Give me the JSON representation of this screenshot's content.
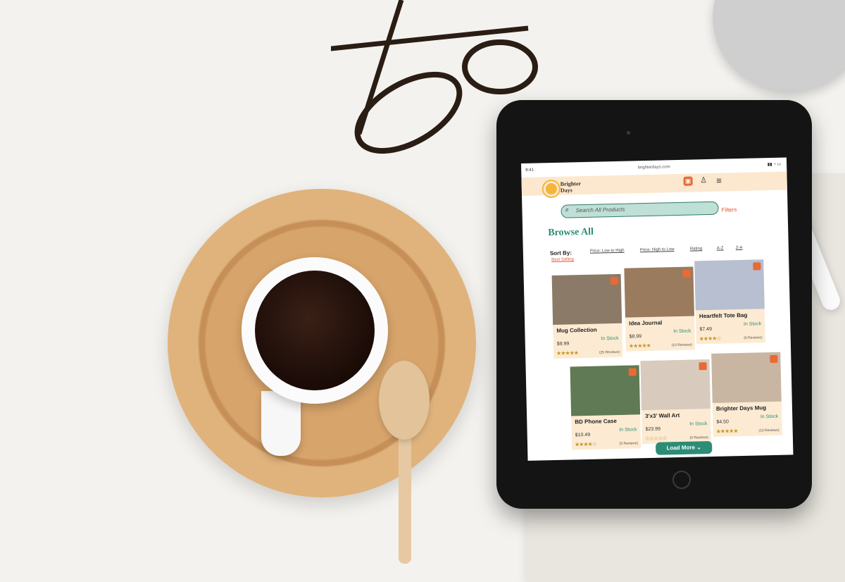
{
  "status": {
    "time": "9:41",
    "url": "brighterdays.com"
  },
  "brand": {
    "line1": "Brighter",
    "line2": "Days"
  },
  "header": {
    "cart_icon": "shopping-bag-icon",
    "account_icon": "user-icon",
    "menu_icon": "hamburger-menu-icon"
  },
  "search": {
    "placeholder": "Search All Products",
    "icon": "search-icon"
  },
  "filters_label": "Filters",
  "page_title": "Browse All",
  "sort": {
    "label": "Sort By:",
    "selected": "Best Selling",
    "options": [
      "Price: Low to High",
      "Price: High to Low",
      "Rating",
      "A-Z",
      "Z-A"
    ]
  },
  "products": [
    {
      "name": "Mug Collection",
      "price": "$9.99",
      "stock": "In Stock",
      "stars": "★★★★★",
      "reviews": "(25 Reviews)"
    },
    {
      "name": "Idea Journal",
      "price": "$8.99",
      "stock": "In Stock",
      "stars": "★★★★★",
      "reviews": "(10 Reviews)"
    },
    {
      "name": "Heartfelt Tote Bag",
      "price": "$7.49",
      "stock": "In Stock",
      "stars": "★★★★☆",
      "reviews": "(9 Reviews)"
    },
    {
      "name": "BD Phone Case",
      "price": "$10.49",
      "stock": "In Stock",
      "stars": "★★★★☆",
      "reviews": "(5 Reviews)"
    },
    {
      "name": "3'x3' Wall Art",
      "price": "$23.99",
      "stock": "In Stock",
      "stars": "☆☆☆☆☆",
      "reviews": "(0 Reviews)"
    },
    {
      "name": "Brighter Days Mug",
      "price": "$4.50",
      "stock": "In Stock",
      "stars": "★★★★★",
      "reviews": "(10 Reviews)"
    }
  ],
  "load_more": "Load More ⌄",
  "colors": {
    "accent": "#2c8c75",
    "highlight": "#e2572f",
    "card_bg": "#fcebd2"
  }
}
